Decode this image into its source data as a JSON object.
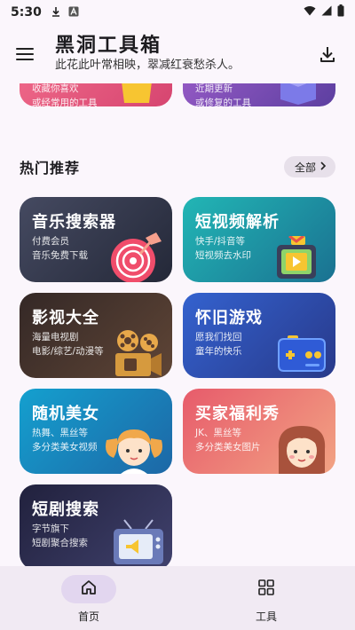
{
  "status_bar": {
    "time": "5:30",
    "icons": [
      "download-icon",
      "a-badge-icon",
      "wifi-icon",
      "signal-icon",
      "battery-icon"
    ]
  },
  "app_bar": {
    "title": "黑洞工具箱",
    "subtitle": "此花此叶常相映，翠减红衰愁杀人。",
    "menu_icon": "menu-icon",
    "download_icon": "download-icon"
  },
  "top_cards": [
    {
      "desc": [
        "收藏你喜欢",
        "或经常用的工具"
      ],
      "color": "#e3567d",
      "art": "shopping-bag-icon"
    },
    {
      "desc": [
        "近期更新",
        "或修复的工具"
      ],
      "color": "#7a4fb0",
      "art": "upgrade-box-icon"
    }
  ],
  "section": {
    "title": "热门推荐",
    "all_label": "全部"
  },
  "cards": [
    {
      "title": "音乐搜索器",
      "desc": [
        "付费会员",
        "音乐免费下载"
      ],
      "from": "#3d4258",
      "to": "#1f2433",
      "art": "music-record-icon"
    },
    {
      "title": "短视频解析",
      "desc": [
        "快手/抖音等",
        "短视频去水印"
      ],
      "from": "#1fa6a8",
      "to": "#1b6f8a",
      "art": "video-tv-icon"
    },
    {
      "title": "影视大全",
      "desc": [
        "海量电视剧",
        "电影/综艺/动漫等"
      ],
      "from": "#3a2e2b",
      "to": "#6a4a3c",
      "art": "film-projector-icon"
    },
    {
      "title": "怀旧游戏",
      "desc": [
        "愿我们找回",
        "童年的快乐"
      ],
      "from": "#2d5cc8",
      "to": "#2a3f8c",
      "art": "gamepad-icon"
    },
    {
      "title": "随机美女",
      "desc": [
        "热舞、黑丝等",
        "多分类美女视频"
      ],
      "from": "#1397c6",
      "to": "#1e6aa8",
      "art": "girl-avatar-icon"
    },
    {
      "title": "买家福利秀",
      "desc": [
        "JK、黑丝等",
        "多分类美女图片"
      ],
      "from": "#e8606b",
      "to": "#f19a7f",
      "art": "woman-avatar-icon"
    },
    {
      "title": "短剧搜索",
      "desc": [
        "字节旗下",
        "短剧聚合搜索"
      ],
      "from": "#222240",
      "to": "#3e3f6b",
      "art": "retro-tv-icon"
    }
  ],
  "bottom_nav": [
    {
      "label": "首页",
      "icon": "home-icon",
      "active": true
    },
    {
      "label": "工具",
      "icon": "grid-icon",
      "active": false
    }
  ]
}
